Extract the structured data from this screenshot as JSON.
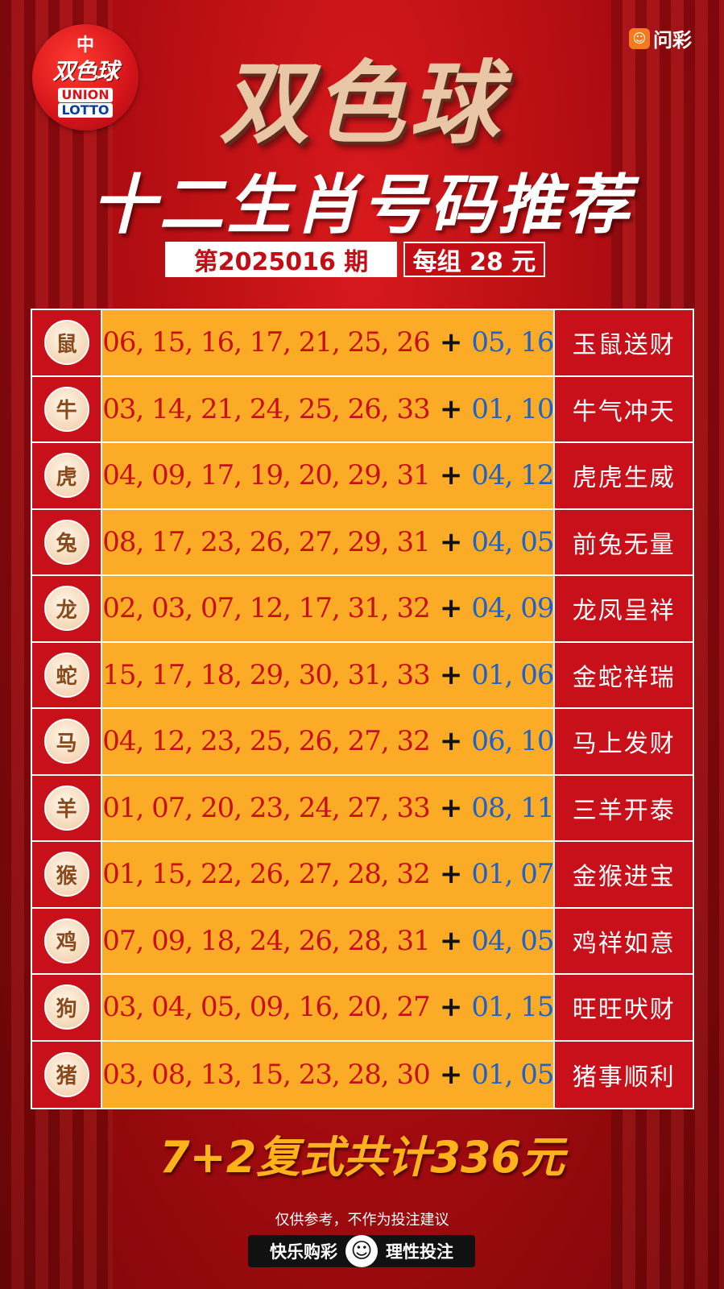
{
  "logo": {
    "top_char": "中",
    "name": "双色球",
    "union": "UNION",
    "lotto": "LOTTO"
  },
  "brand": {
    "icon": "wencai-icon",
    "name": "问彩"
  },
  "title": "双色球",
  "subtitle": "十二生肖号码推荐",
  "issue": "第2025016 期",
  "price": "每组 28 元",
  "rows": [
    {
      "icon": "rat-icon",
      "glyph": "鼠",
      "reds": "06, 15, 16, 17, 21, 25, 26",
      "blues": "05, 16",
      "name": "玉鼠送财"
    },
    {
      "icon": "ox-icon",
      "glyph": "牛",
      "reds": "03, 14, 21, 24, 25, 26, 33",
      "blues": "01, 10",
      "name": "牛气冲天"
    },
    {
      "icon": "tiger-icon",
      "glyph": "虎",
      "reds": "04, 09, 17, 19, 20, 29, 31",
      "blues": "04, 12",
      "name": "虎虎生威"
    },
    {
      "icon": "rabbit-icon",
      "glyph": "兔",
      "reds": "08, 17, 23, 26, 27, 29, 31",
      "blues": "04, 05",
      "name": "前兔无量"
    },
    {
      "icon": "dragon-icon",
      "glyph": "龙",
      "reds": "02, 03, 07, 12, 17, 31, 32",
      "blues": "04, 09",
      "name": "龙凤呈祥"
    },
    {
      "icon": "snake-icon",
      "glyph": "蛇",
      "reds": "15, 17, 18, 29, 30, 31, 33",
      "blues": "01, 06",
      "name": "金蛇祥瑞"
    },
    {
      "icon": "horse-icon",
      "glyph": "马",
      "reds": "04, 12, 23, 25, 26, 27, 32",
      "blues": "06, 10",
      "name": "马上发财"
    },
    {
      "icon": "goat-icon",
      "glyph": "羊",
      "reds": "01, 07, 20, 23, 24, 27, 33",
      "blues": "08, 11",
      "name": "三羊开泰"
    },
    {
      "icon": "monkey-icon",
      "glyph": "猴",
      "reds": "01, 15, 22, 26, 27, 28, 32",
      "blues": "01, 07",
      "name": "金猴进宝"
    },
    {
      "icon": "rooster-icon",
      "glyph": "鸡",
      "reds": "07, 09, 18, 24, 26, 28, 31",
      "blues": "04, 05",
      "name": "鸡祥如意"
    },
    {
      "icon": "dog-icon",
      "glyph": "狗",
      "reds": "03, 04, 05, 09, 16, 20, 27",
      "blues": "01, 15",
      "name": "旺旺吠财"
    },
    {
      "icon": "pig-icon",
      "glyph": "猪",
      "reds": "03, 08, 13, 15, 23, 28, 30",
      "blues": "01, 05",
      "name": "猪事顺利"
    }
  ],
  "plus": "+",
  "total": "7+2复式共计336元",
  "disclaimer": "仅供参考，不作为投注建议",
  "footer": {
    "left": "快乐购彩",
    "right": "理性投注",
    "icon": "smiley-icon"
  },
  "colors": {
    "background": "#b10d12",
    "numbers_bg": "#fbab26",
    "red_ball": "#c8101a",
    "blue_ball": "#1f63c8",
    "total": "#ffb21c"
  }
}
